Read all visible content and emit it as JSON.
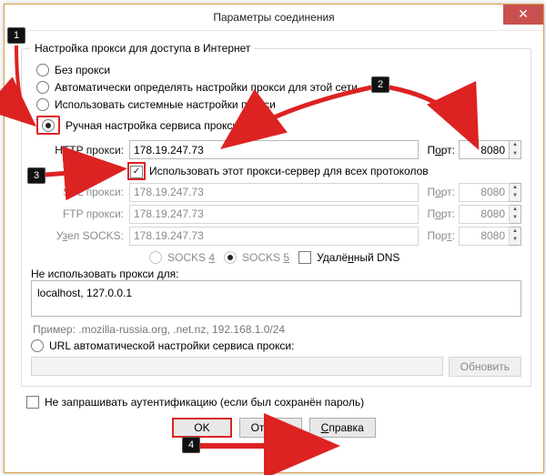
{
  "window": {
    "title": "Параметры соединения"
  },
  "group": {
    "legend": "Настройка прокси для доступа в Интернет",
    "opt_none": "Без прокси",
    "opt_auto": "Автоматически определять настройки прокси для этой сети",
    "opt_system": "Использовать системные настройки прокси",
    "opt_manual": "Ручная настройка сервиса прокси:"
  },
  "proxy": {
    "http_label": "HTTP прокси:",
    "http_addr": "178.19.247.73",
    "http_port": "8080",
    "use_all": "Использовать этот прокси-сервер для всех протоколов",
    "ssl_label": "SSL прокси:",
    "ssl_addr": "178.19.247.73",
    "ssl_port": "8080",
    "ftp_label": "FTP прокси:",
    "ftp_addr": "178.19.247.73",
    "ftp_port": "8080",
    "socks_label": "Узел SOCKS:",
    "socks_addr": "178.19.247.73",
    "socks_port": "8080",
    "port_label": "Порт:",
    "socks4": "SOCKS 4",
    "socks5": "SOCKS 5",
    "remote_dns": "Удалённый DNS"
  },
  "noproxy": {
    "label": "Не использовать прокси для:",
    "value": "localhost, 127.0.0.1",
    "hint": "Пример: .mozilla-russia.org, .net.nz, 192.168.1.0/24"
  },
  "autourl": {
    "label": "URL автоматической настройки сервиса прокси:",
    "reload": "Обновить"
  },
  "auth": {
    "label": "Не запрашивать аутентификацию (если был сохранён пароль)"
  },
  "buttons": {
    "ok": "OK",
    "cancel": "Отмена",
    "help": "Справка"
  },
  "annotations": {
    "n1": "1",
    "n2": "2",
    "n3": "3",
    "n4": "4"
  }
}
